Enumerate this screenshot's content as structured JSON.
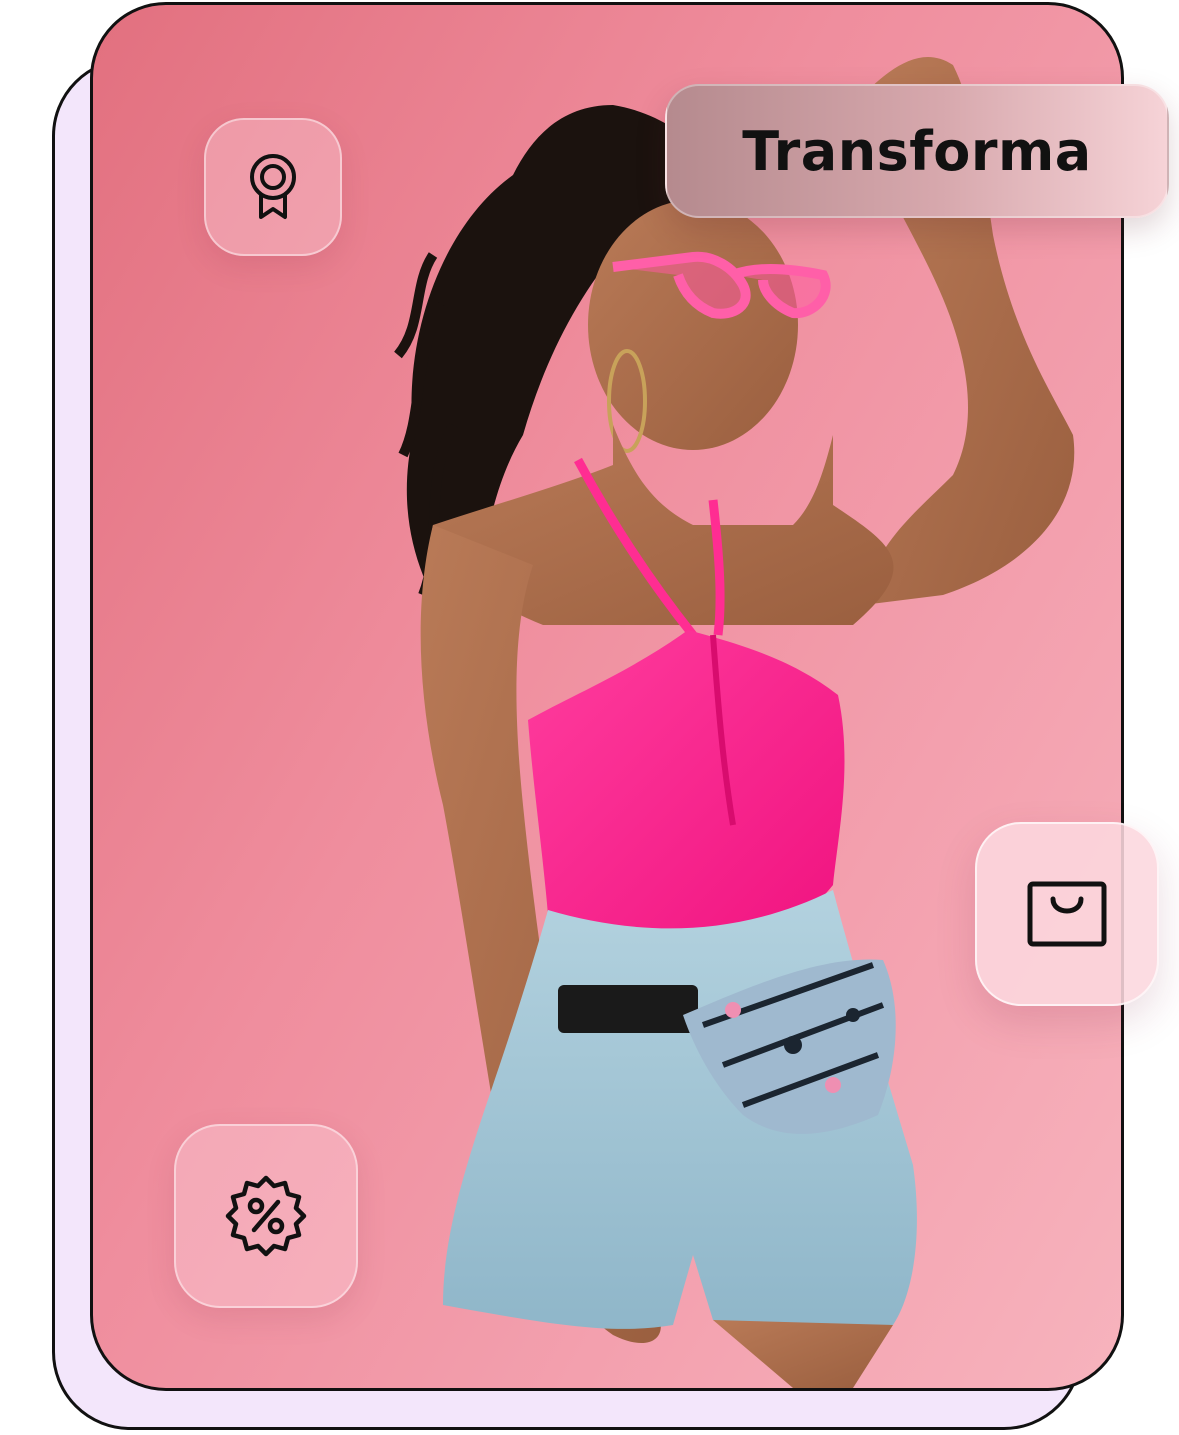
{
  "title": {
    "text": "Transforma"
  },
  "icons": {
    "award": "award-ribbon-icon",
    "discount": "discount-percent-badge-icon",
    "bag": "shopping-bag-icon"
  },
  "colors": {
    "card_border": "#111111",
    "back_card": "#f3e6fb",
    "photo_background": "#ef8d9d",
    "top_pink": "#ff1f8e",
    "denim": "#9fc2d3",
    "icon_stroke": "#111111"
  }
}
